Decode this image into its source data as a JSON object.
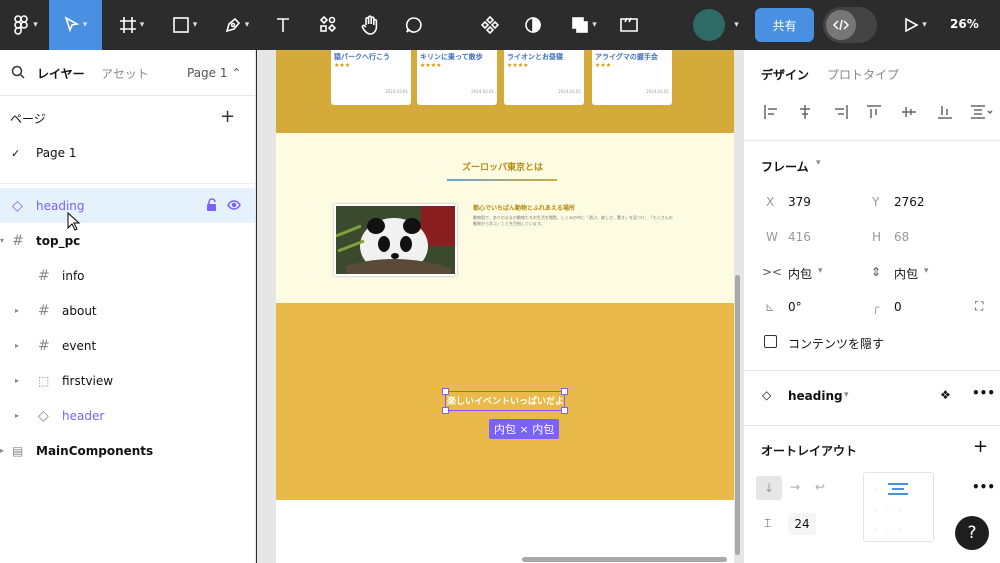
{
  "toolbar": {
    "share_label": "共有",
    "zoom": "26%"
  },
  "left_panel": {
    "tab_layers": "レイヤー",
    "tab_assets": "アセット",
    "page_selector": "Page 1",
    "pages_heading": "ページ",
    "current_page": "Page 1",
    "layers": [
      {
        "name": "heading"
      },
      {
        "name": "top_pc"
      },
      {
        "name": "info"
      },
      {
        "name": "about"
      },
      {
        "name": "event"
      },
      {
        "name": "firstview"
      },
      {
        "name": "header"
      },
      {
        "name": "MainComponents"
      }
    ]
  },
  "canvas": {
    "cards": [
      {
        "title": "猿パークへ行こう",
        "stars": "★★★",
        "date": "2024.03.01"
      },
      {
        "title": "キリンに乗って散歩",
        "stars": "★★★★",
        "date": "2024.03.01"
      },
      {
        "title": "ライオンとお昼寝",
        "stars": "★★★★",
        "date": "2024.03.01"
      },
      {
        "title": "アライグマの握手会",
        "stars": "★★★",
        "date": "2024.03.01"
      }
    ],
    "about_title": "ズーロッパ東京とは",
    "about_heading": "都心でいちばん動物とふれあえる場所",
    "about_body": "動物園で、ありのままの動物たちの生活を閲覧。しくみの中に「遊ぶ、楽しさ、驚き」を見つけ、「たくさんの動物から学ぶ」ことを目指しています。",
    "event_title": "楽しいイベントいっぱいだよ",
    "size_badge": "内包 × 内包"
  },
  "right_panel": {
    "tab_design": "デザイン",
    "tab_prototype": "プロトタイプ",
    "frame_label": "フレーム",
    "x_label": "X",
    "x_value": "379",
    "y_label": "Y",
    "y_value": "2762",
    "w_label": "W",
    "w_value": "416",
    "h_label": "H",
    "h_value": "68",
    "hug_h": "内包",
    "hug_v": "内包",
    "rotation": "0°",
    "radius": "0",
    "clip_label": "コンテンツを隠す",
    "component_name": "heading",
    "autolayout_label": "オートレイアウト",
    "gap": "24"
  },
  "colors": {
    "accent": "#4a90e2",
    "selection": "#7b61ff",
    "band_gold": "#e9b94a"
  }
}
